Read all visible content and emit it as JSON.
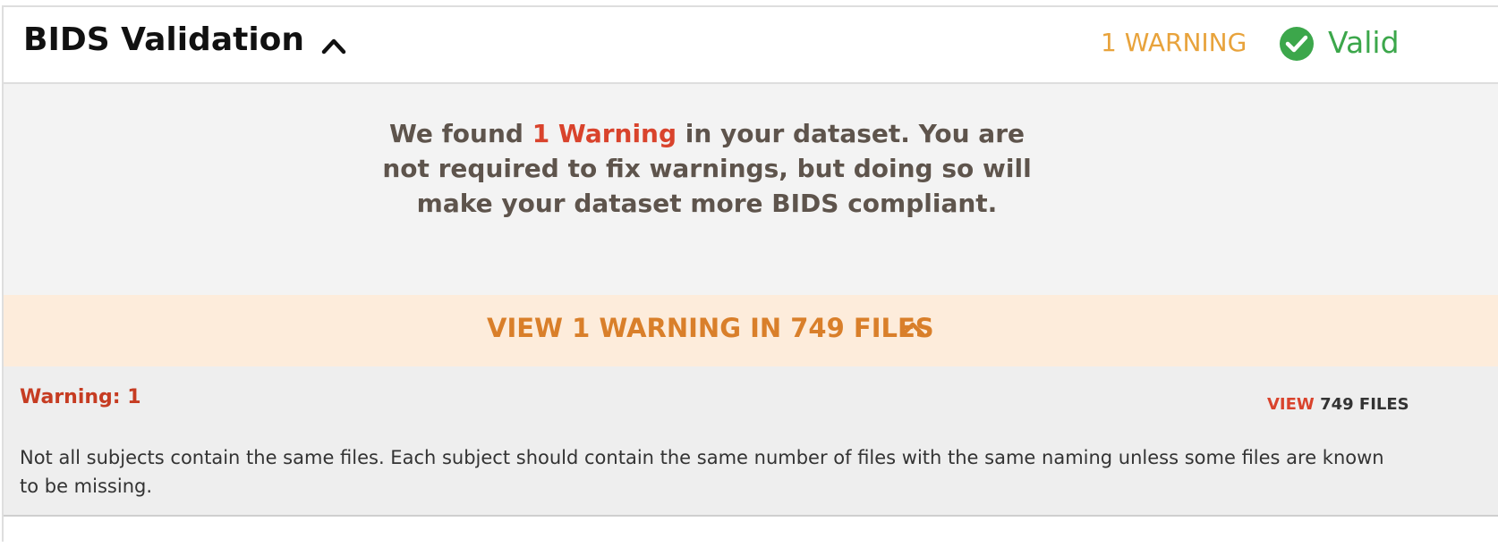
{
  "header": {
    "title": "BIDS Validation",
    "warning_count": "1 WARNING",
    "status_label": "Valid",
    "colors": {
      "warning": "#e8a33c",
      "valid": "#3ca74b"
    },
    "icons": {
      "collapse": "chevron-up-icon",
      "status": "check-circle-icon"
    }
  },
  "summary": {
    "prefix": "We found ",
    "highlight": "1 Warning",
    "suffix": " in your dataset. You are not required to fix warnings, but doing so will make your dataset more BIDS compliant.",
    "highlight_color": "#d9432c"
  },
  "view_bar": {
    "label": "VIEW 1 WARNING IN 749 FILES",
    "icon": "chevron-up-icon",
    "color": "#d97f2a"
  },
  "warning": {
    "title": "Warning: 1",
    "view_label": "VIEW",
    "files_label": "749 FILES",
    "description": "Not all subjects contain the same files. Each subject should contain the same number of files with the same naming unless some files are known to be missing."
  }
}
